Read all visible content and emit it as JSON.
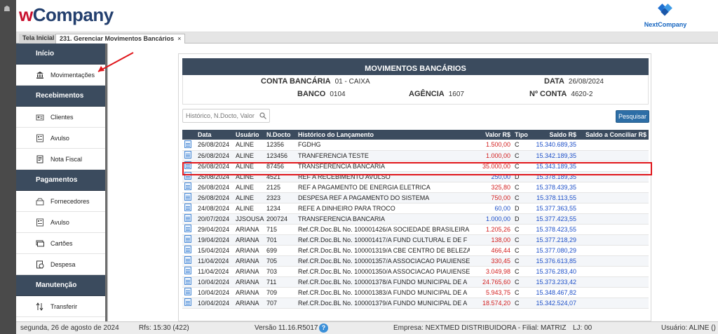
{
  "header": {
    "logo_w": "w",
    "logo_rest": "Company",
    "brand_right": "NextCompany"
  },
  "tabs": [
    {
      "label": "Tela Inicial"
    },
    {
      "label": "231. Gerenciar Movimentos Bancários",
      "close": "×"
    }
  ],
  "sidebar": {
    "sections": [
      {
        "title": "Início",
        "items": [
          {
            "label": "Movimentações",
            "icon": "bank-icon"
          }
        ]
      },
      {
        "title": "Recebimentos",
        "items": [
          {
            "label": "Clientes",
            "icon": "clients-icon"
          },
          {
            "label": "Avulso",
            "icon": "receipt-icon"
          },
          {
            "label": "Nota Fiscal",
            "icon": "invoice-icon"
          }
        ]
      },
      {
        "title": "Pagamentos",
        "items": [
          {
            "label": "Fornecedores",
            "icon": "suppliers-icon"
          },
          {
            "label": "Avulso",
            "icon": "receipt-icon"
          },
          {
            "label": "Cartões",
            "icon": "cards-icon"
          },
          {
            "label": "Despesa",
            "icon": "expense-icon"
          }
        ]
      },
      {
        "title": "Manutenção",
        "items": [
          {
            "label": "Transferir",
            "icon": "transfer-icon"
          }
        ]
      }
    ]
  },
  "panel": {
    "title": "MOVIMENTOS BANCÁRIOS",
    "info": {
      "conta_label": "CONTA BANCÁRIA",
      "conta_value": "01 - CAIXA",
      "data_label": "DATA",
      "data_value": "26/08/2024",
      "banco_label": "BANCO",
      "banco_value": "0104",
      "agencia_label": "AGÊNCIA",
      "agencia_value": "1607",
      "nconta_label": "Nº CONTA",
      "nconta_value": "4620-2"
    },
    "search_placeholder": "Histórico, N.Docto, Valor",
    "search_button": "Pesquisar"
  },
  "table": {
    "headers": [
      "",
      "Data",
      "Usuário",
      "N.Docto",
      "Histórico do Lançamento",
      "Valor R$",
      "Tipo",
      "Saldo R$",
      "Saldo a Conciliar R$"
    ],
    "rows": [
      [
        "26/08/2024",
        "ALINE",
        "12356",
        "FGDHG",
        "1.500,00",
        "C",
        "15.340.689,35",
        ""
      ],
      [
        "26/08/2024",
        "ALINE",
        "123456",
        "TRANFERENCIA TESTE",
        "1.000,00",
        "C",
        "15.342.189,35",
        ""
      ],
      [
        "26/08/2024",
        "ALINE",
        "87456",
        "TRANSFERENCIA BANCARIA",
        "35.000,00",
        "C",
        "15.343.189,35",
        ""
      ],
      [
        "26/08/2024",
        "ALINE",
        "4521",
        "REF A RECEBIMENTO AVULSO",
        "250,00",
        "D",
        "15.378.189,35",
        ""
      ],
      [
        "26/08/2024",
        "ALINE",
        "2125",
        "REF A PAGAMENTO DE ENERGIA ELETRICA",
        "325,80",
        "C",
        "15.378.439,35",
        ""
      ],
      [
        "26/08/2024",
        "ALINE",
        "2323",
        "DESPESA REF A PAGAMENTO DO SISTEMA",
        "750,00",
        "C",
        "15.378.113,55",
        ""
      ],
      [
        "24/08/2024",
        "ALINE",
        "1234",
        "REFE A DINHEIRO PARA TROCO",
        "60,00",
        "D",
        "15.377.363,55",
        ""
      ],
      [
        "20/07/2024",
        "JJSOUSA",
        "200724",
        "TRANSFERENCIA BANCARIA",
        "1.000,00",
        "D",
        "15.377.423,55",
        ""
      ],
      [
        "29/04/2024",
        "ARIANA",
        "715",
        "Ref.CR.Doc.BL No. 100001426/A SOCIEDADE BRASILEIRA",
        "1.205,26",
        "C",
        "15.378.423,55",
        ""
      ],
      [
        "19/04/2024",
        "ARIANA",
        "701",
        "Ref.CR.Doc.BL No. 100001417/A FUND CULTURAL E DE F",
        "138,00",
        "C",
        "15.377.218,29",
        ""
      ],
      [
        "15/04/2024",
        "ARIANA",
        "699",
        "Ref.CR.Doc.BL No. 100001319/A CBE CENTRO DE BELEZA",
        "466,44",
        "C",
        "15.377.080,29",
        ""
      ],
      [
        "11/04/2024",
        "ARIANA",
        "705",
        "Ref.CR.Doc.BL No. 100001357/A ASSOCIACAO PIAUIENSE",
        "330,45",
        "C",
        "15.376.613,85",
        ""
      ],
      [
        "11/04/2024",
        "ARIANA",
        "703",
        "Ref.CR.Doc.BL No. 100001350/A ASSOCIACAO PIAUIENSE",
        "3.049,98",
        "C",
        "15.376.283,40",
        ""
      ],
      [
        "10/04/2024",
        "ARIANA",
        "711",
        "Ref.CR.Doc.BL No. 100001378/A FUNDO MUNICIPAL DE A",
        "24.765,60",
        "C",
        "15.373.233,42",
        ""
      ],
      [
        "10/04/2024",
        "ARIANA",
        "709",
        "Ref.CR.Doc.BL No. 100001383/A FUNDO MUNICIPAL DE A",
        "5.943,75",
        "C",
        "15.348.467,82",
        ""
      ],
      [
        "10/04/2024",
        "ARIANA",
        "707",
        "Ref.CR.Doc.BL No. 100001379/A FUNDO MUNICIPAL DE A",
        "18.574,20",
        "C",
        "15.342.524,07",
        ""
      ]
    ]
  },
  "status": {
    "date": "segunda, 26 de agosto de 2024",
    "rfs": "Rfs: 15:30 (422)",
    "version": "Versão 11.16.R5017",
    "help": "?",
    "empresa": "Empresa: NEXTMED DISTRIBUIDORA - Filial: MATRIZ",
    "lj": "LJ: 00",
    "usuario": "Usuário: ALINE ()"
  },
  "colors": {
    "dark_header": "#3b4b5e",
    "credit": "#d32020",
    "debit": "#1e50c8",
    "highlight": "#e0161b"
  }
}
